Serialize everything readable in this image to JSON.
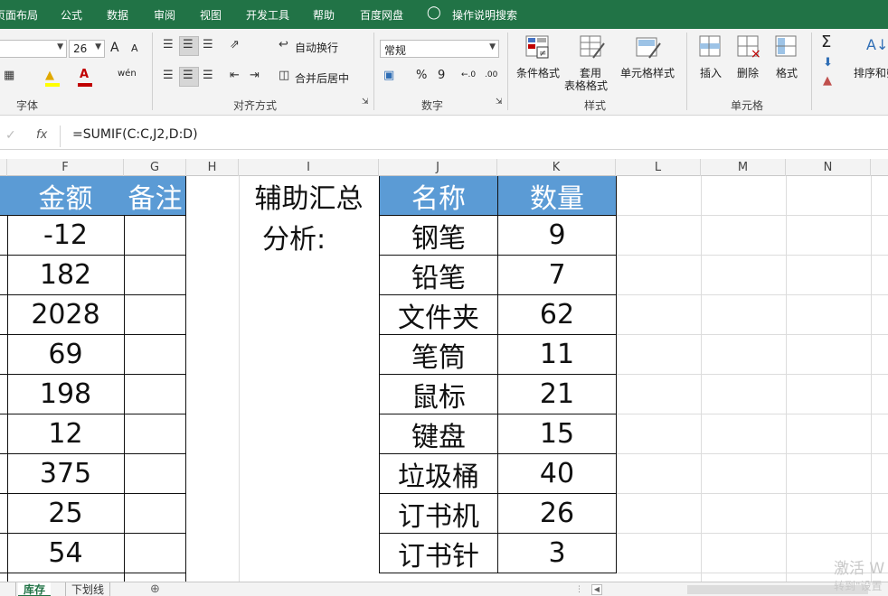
{
  "menu": {
    "items": [
      "页面布局",
      "公式",
      "数据",
      "审阅",
      "视图",
      "开发工具",
      "帮助",
      "百度网盘"
    ],
    "tell_me": "操作说明搜索"
  },
  "ribbon": {
    "font_size": "26",
    "font_group_label": "字体",
    "wrap_text": "自动换行",
    "merge_center": "合并后居中",
    "alignment_group_label": "对齐方式",
    "number_format": "常规",
    "number_group_label": "数字",
    "cond_format": "条件格式",
    "table_format_1": "套用",
    "table_format_2": "表格格式",
    "cell_styles": "单元格样式",
    "styles_group_label": "样式",
    "insert": "插入",
    "delete": "删除",
    "format": "格式",
    "cells_group_label": "单元格",
    "sort_filter": "排序和筛",
    "sigma": "Σ",
    "percent": "%",
    "comma": "9",
    "inc_dec": "←.0",
    "dec_dec": ".00",
    "font_inc": "A",
    "font_dec": "A",
    "wen": "wén"
  },
  "formula_bar": {
    "fx": "fx",
    "formula": "=SUMIF(C:C,J2,D:D)"
  },
  "columns": [
    "F",
    "G",
    "H",
    "I",
    "J",
    "K",
    "L",
    "M",
    "N"
  ],
  "left_table": {
    "header_amount": "金额",
    "header_note": "备注",
    "amounts": [
      "-12",
      "182",
      "2028",
      "69",
      "198",
      "12",
      "375",
      "25",
      "54"
    ]
  },
  "helper_label": [
    "辅助汇总",
    "分析:"
  ],
  "right_table": {
    "header_name": "名称",
    "header_qty": "数量",
    "rows": [
      {
        "name": "钢笔",
        "qty": "9"
      },
      {
        "name": "铅笔",
        "qty": "7"
      },
      {
        "name": "文件夹",
        "qty": "62"
      },
      {
        "name": "笔筒",
        "qty": "11"
      },
      {
        "name": "鼠标",
        "qty": "21"
      },
      {
        "name": "键盘",
        "qty": "15"
      },
      {
        "name": "垃圾桶",
        "qty": "40"
      },
      {
        "name": "订书机",
        "qty": "26"
      },
      {
        "name": "订书针",
        "qty": "3"
      }
    ]
  },
  "tabs": [
    "库存",
    "下划线"
  ],
  "add_sheet": "⊕",
  "watermark": {
    "line1": "激活 W",
    "line2": "转到\"设置"
  },
  "colors": {
    "excel_green": "#217346",
    "header_blue": "#5b9bd5"
  }
}
